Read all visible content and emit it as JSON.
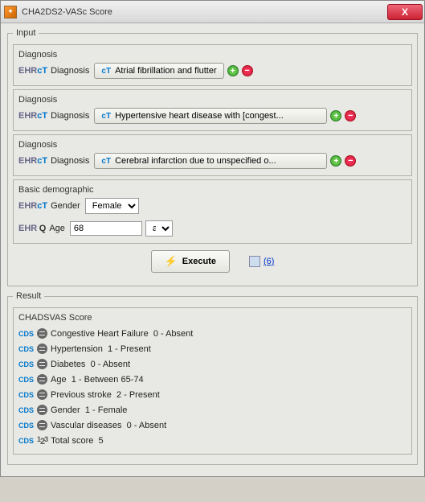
{
  "window": {
    "title": "CHA2DS2-VASc Score"
  },
  "input_legend": "Input",
  "diagnosis_label": "Diagnosis",
  "diagnosis_field": "Diagnosis",
  "diagnoses": [
    {
      "value": "Atrial fibrillation and flutter"
    },
    {
      "value": "Hypertensive heart disease with [congest..."
    },
    {
      "value": "Cerebral infarction due to unspecified o..."
    }
  ],
  "demographic_label": "Basic demographic",
  "gender": {
    "label": "Gender",
    "value": "Female"
  },
  "age": {
    "label": "Age",
    "value": "68",
    "unit": "a"
  },
  "execute_label": "Execute",
  "archive": {
    "count": "(6)"
  },
  "result_legend": "Result",
  "score_label": "CHADSVAS Score",
  "results": [
    {
      "label": "Congestive Heart Failure",
      "value": "0 - Absent"
    },
    {
      "label": "Hypertension",
      "value": "1 - Present"
    },
    {
      "label": "Diabetes",
      "value": "0 - Absent"
    },
    {
      "label": "Age",
      "value": "1 - Between 65-74"
    },
    {
      "label": "Previous stroke",
      "value": "2 - Present"
    },
    {
      "label": "Gender",
      "value": "1 - Female"
    },
    {
      "label": "Vascular diseases",
      "value": "0 - Absent"
    }
  ],
  "total": {
    "label": "Total score",
    "value": "5"
  }
}
